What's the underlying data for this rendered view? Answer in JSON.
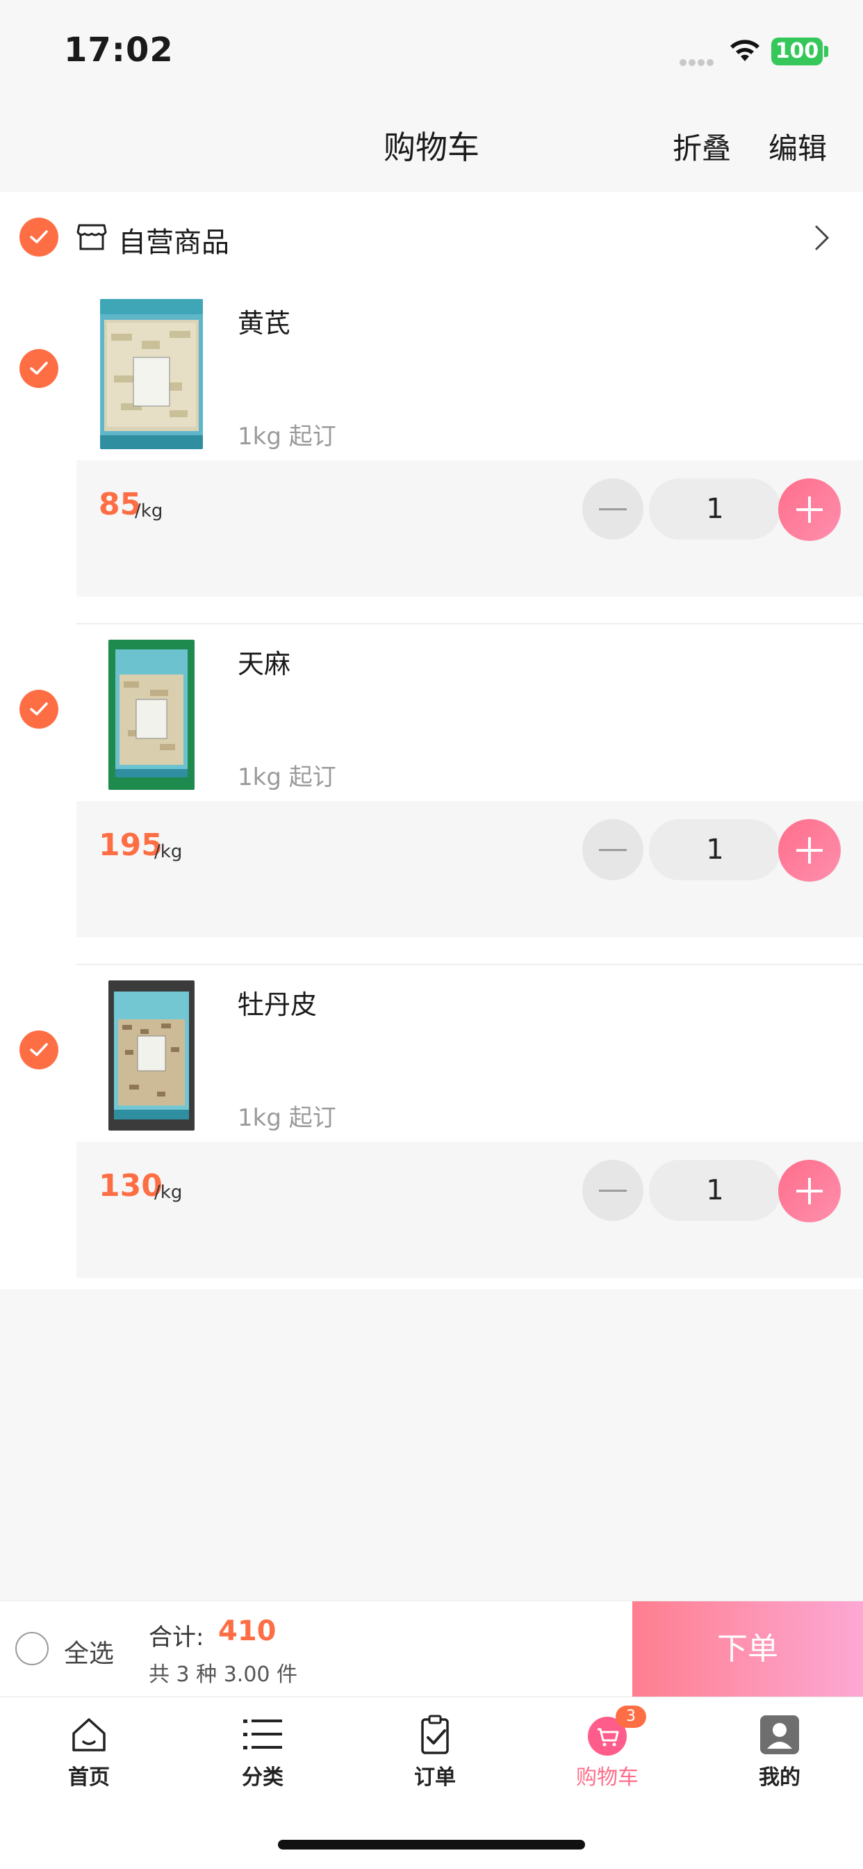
{
  "status_bar": {
    "time": "17:02",
    "battery": "100"
  },
  "header": {
    "title": "购物车",
    "fold_label": "折叠",
    "edit_label": "编辑"
  },
  "store": {
    "name": "自营商品"
  },
  "items": [
    {
      "name": "黄芪",
      "moq": "1kg 起订",
      "price": "85",
      "unit": "/kg",
      "quantity": "1"
    },
    {
      "name": "天麻",
      "moq": "1kg 起订",
      "price": "195",
      "unit": "/kg",
      "quantity": "1"
    },
    {
      "name": "牡丹皮",
      "moq": "1kg 起订",
      "price": "130",
      "unit": "/kg",
      "quantity": "1"
    }
  ],
  "summary": {
    "select_all_label": "全选",
    "total_label": "合计:",
    "total_value": "410",
    "count_text": "共 3 种 3.00 件",
    "order_label": "下单"
  },
  "tabbar": {
    "tabs": [
      {
        "label": "首页",
        "icon": "home-icon"
      },
      {
        "label": "分类",
        "icon": "list-icon"
      },
      {
        "label": "订单",
        "icon": "clipboard-icon"
      },
      {
        "label": "购物车",
        "icon": "cart-icon",
        "badge": "3",
        "active": true
      },
      {
        "label": "我的",
        "icon": "user-icon"
      }
    ]
  },
  "colors": {
    "accent": "#fe6e45",
    "pink": "#fe6e8a",
    "order_gradient_end": "#fda8d4"
  }
}
